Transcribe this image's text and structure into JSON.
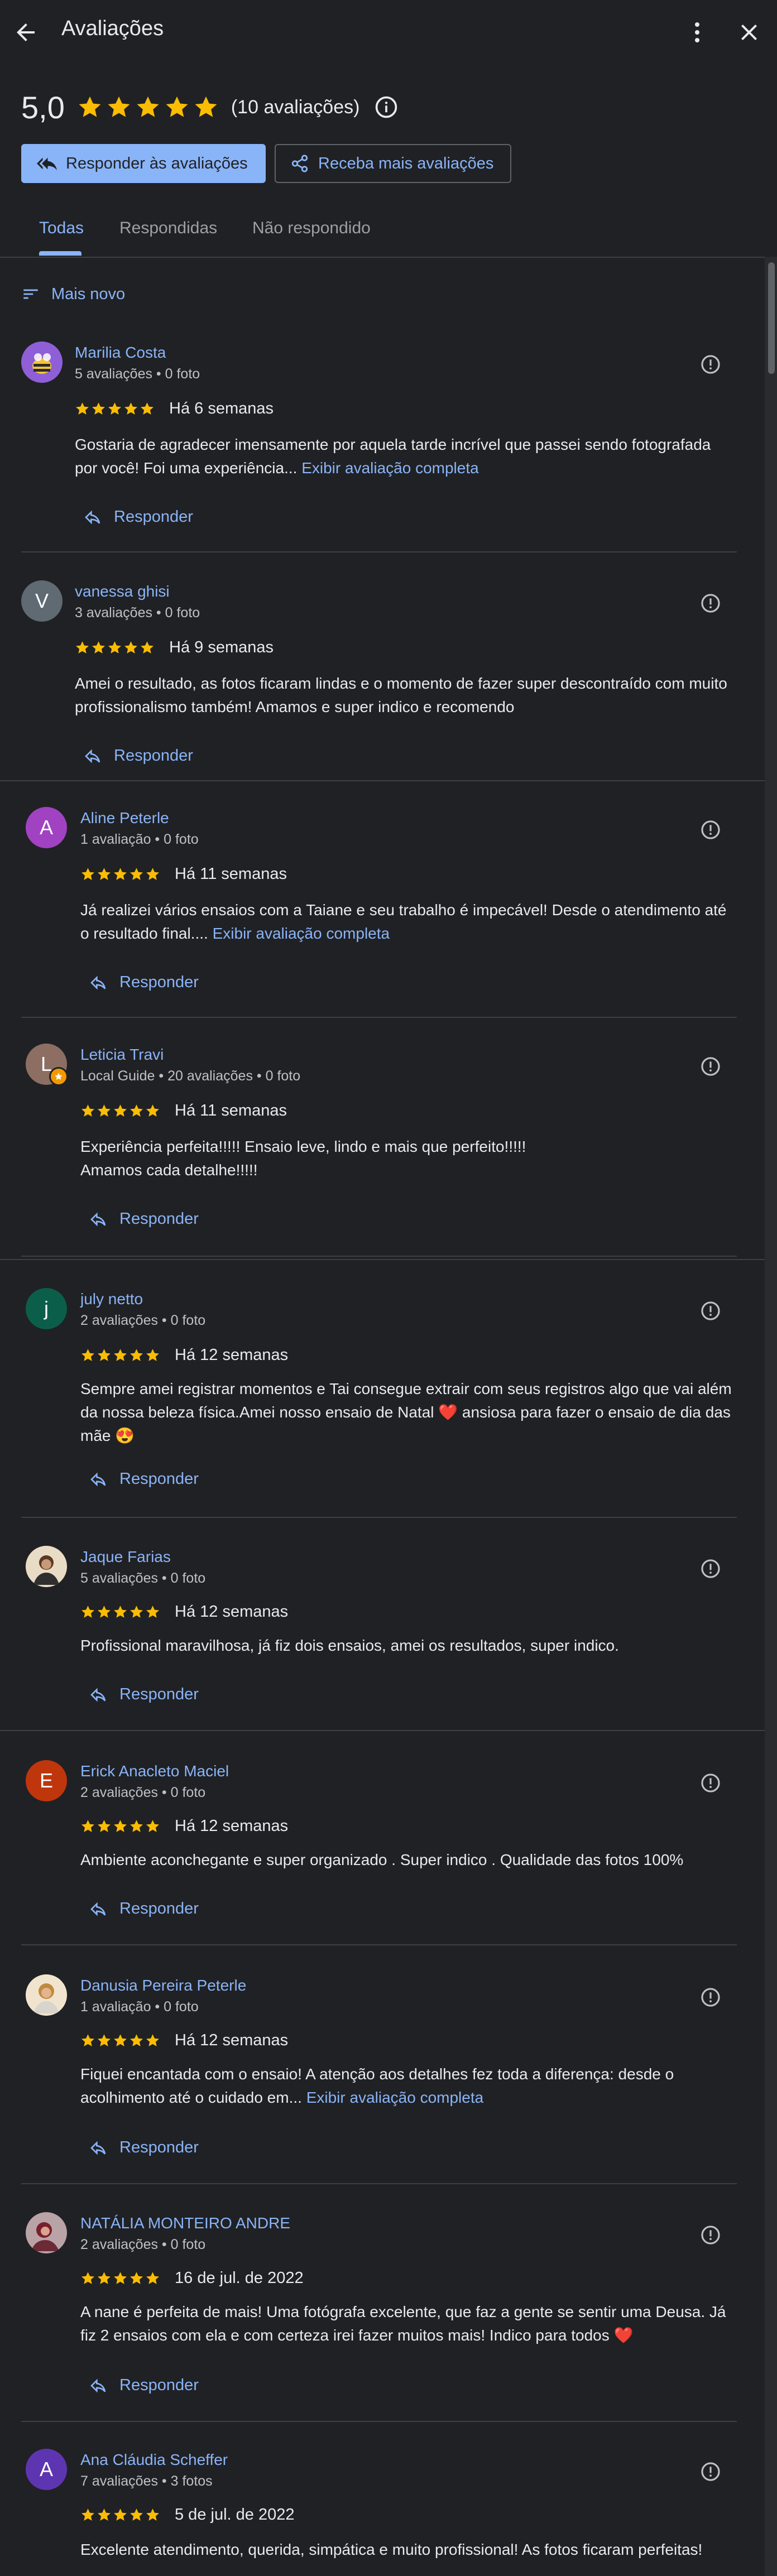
{
  "header": {
    "title": "Avaliações"
  },
  "summary": {
    "score": "5,0",
    "count": "(10 avaliações)"
  },
  "actions": {
    "respond": "Responder às avaliações",
    "get_more": "Receba mais avaliações"
  },
  "tabs": [
    {
      "label": "Todas"
    },
    {
      "label": "Respondidas"
    },
    {
      "label": "Não respondido"
    }
  ],
  "sort": {
    "label": "Mais novo"
  },
  "reply_label": "Responder",
  "reviews": [
    {
      "name": "Marilia Costa",
      "meta": "5 avaliações • 0 foto",
      "date": "Há 6 semanas",
      "text": "Gostaria de agradecer imensamente por aquela tarde incrível que passei sendo fotografada por você! Foi uma experiência...",
      "more": "Exibir avaliação completa",
      "avatar_letter": "",
      "avatar_color": "#7b4fc9"
    },
    {
      "name": "vanessa ghisi",
      "meta": "3 avaliações • 0 foto",
      "date": "Há 9 semanas",
      "text": "Amei o resultado, as fotos ficaram lindas e o momento de fazer super descontraído com muito profissionalismo também! Amamos e super indico e recomendo",
      "more": "",
      "avatar_letter": "V",
      "avatar_color": "#5f6a73"
    },
    {
      "name": "Aline Peterle",
      "meta": "1 avaliação • 0 foto",
      "date": "Há 11 semanas",
      "text": "Já realizei vários ensaios com a Taiane e seu trabalho é impecável! Desde o atendimento até o resultado final....",
      "more": "Exibir avaliação completa",
      "avatar_letter": "A",
      "avatar_color": "#a142c2"
    },
    {
      "name": "Leticia Travi",
      "meta": "Local Guide • 20 avaliações • 0 foto",
      "date": "Há 11 semanas",
      "text": "Experiência perfeita!!!!! Ensaio leve, lindo e mais que perfeito!!!!!\nAmamos cada detalhe!!!!!",
      "more": "",
      "avatar_letter": "L",
      "avatar_color": "#8d6e63"
    },
    {
      "name": "july netto",
      "meta": "2 avaliações • 0 foto",
      "date": "Há 12 semanas",
      "text": "Sempre amei registrar momentos e Tai consegue extrair com seus registros algo que vai além da nossa beleza física.Amei nosso ensaio de Natal ❤️ ansiosa para fazer o ensaio de dia das mãe 😍",
      "more": "",
      "avatar_letter": "j",
      "avatar_color": "#0b5e4a"
    },
    {
      "name": "Jaque Farias",
      "meta": "5 avaliações • 0 foto",
      "date": "Há 12 semanas",
      "text": "Profissional maravilhosa, já fiz dois ensaios, amei os resultados, super indico.",
      "more": "",
      "avatar_letter": "",
      "avatar_color": "#d7c4a8"
    },
    {
      "name": "Erick Anacleto Maciel",
      "meta": "2 avaliações • 0 foto",
      "date": "Há 12 semanas",
      "text": "Ambiente aconchegante e super organizado . Super indico . Qualidade das fotos 100%",
      "more": "",
      "avatar_letter": "E",
      "avatar_color": "#bf360c"
    },
    {
      "name": "Danusia Pereira Peterle",
      "meta": "1 avaliação • 0 foto",
      "date": "Há 12 semanas",
      "text": "Fiquei encantada com o ensaio! A atenção aos detalhes fez toda a diferença: desde o acolhimento até o cuidado em...",
      "more": "Exibir avaliação completa",
      "avatar_letter": "",
      "avatar_color": "#e0c3a0"
    },
    {
      "name": "NATÁLIA MONTEIRO ANDRE",
      "meta": "2 avaliações • 0 foto",
      "date": "16 de jul. de 2022",
      "text": "A nane é perfeita de mais! Uma fotógrafa excelente, que faz a gente se sentir uma Deusa. Já fiz 2 ensaios com ela e com certeza irei fazer muitos mais! Indico para todos ❤️",
      "more": "",
      "avatar_letter": "",
      "avatar_color": "#9c4f5c"
    },
    {
      "name": "Ana Cláudia Scheffer",
      "meta": "7 avaliações • 3 fotos",
      "date": "5 de jul. de 2022",
      "text": "Excelente atendimento, querida, simpática e muito profissional! As fotos ficaram perfeitas!",
      "more": "",
      "avatar_letter": "A",
      "avatar_color": "#5e35b1"
    }
  ]
}
